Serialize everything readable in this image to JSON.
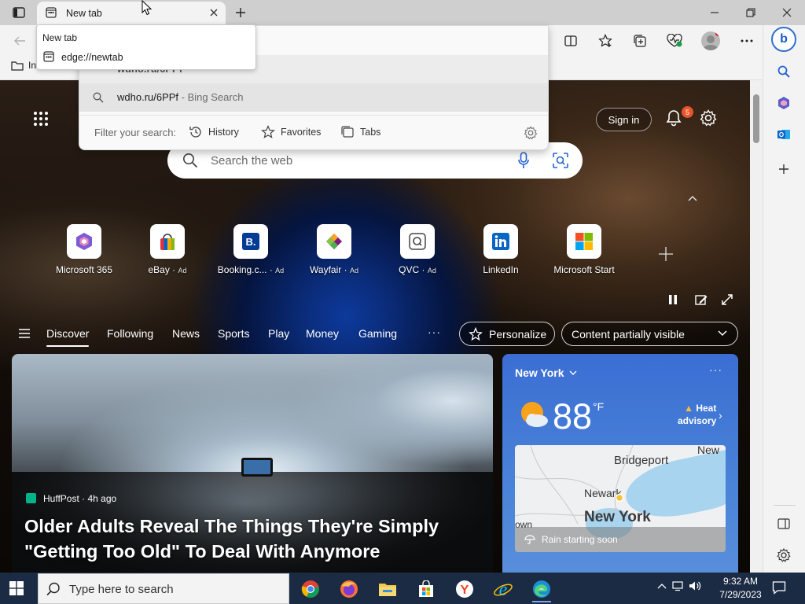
{
  "browser": {
    "tab": {
      "title": "New tab",
      "tooltip_title": "New tab",
      "tooltip_url": "edge://newtab"
    },
    "favorites_bar_item": "In"
  },
  "omnibox": {
    "suggestion_partial": "wdho.ru/6PPf",
    "suggestion_query": "wdho.ru/6PPf",
    "suggestion_engine": " - Bing Search",
    "filter_label": "Filter your search:",
    "filters": [
      "History",
      "Favorites",
      "Tabs"
    ]
  },
  "ntp": {
    "signin_label": "Sign in",
    "notification_count": "5",
    "search_placeholder": "Search the web",
    "tiles": [
      {
        "label": "Microsoft 365",
        "ad": ""
      },
      {
        "label": "eBay",
        "ad": "Ad"
      },
      {
        "label": "Booking.c...",
        "ad": "Ad"
      },
      {
        "label": "Wayfair",
        "ad": "Ad"
      },
      {
        "label": "QVC",
        "ad": "Ad"
      },
      {
        "label": "LinkedIn",
        "ad": ""
      },
      {
        "label": "Microsoft Start",
        "ad": ""
      }
    ],
    "nav": [
      "Discover",
      "Following",
      "News",
      "Sports",
      "Play",
      "Money",
      "Gaming"
    ],
    "nav_more": "···",
    "personalize_label": "Personalize",
    "content_visibility_label": "Content partially visible"
  },
  "news": {
    "source": "HuffPost · 4h ago",
    "headline": "Older Adults Reveal The Things They're Simply \"Getting Too Old\" To Deal With Anymore"
  },
  "weather": {
    "location": "New York",
    "temperature": "88",
    "unit": "°F",
    "alert_line1": "Heat",
    "alert_line2": "advisory",
    "map_labels": [
      "Bridgeport",
      "New",
      "Newark",
      "New York",
      "own"
    ],
    "rain_text": "Rain starting soon"
  },
  "taskbar": {
    "search_placeholder": "Type here to search",
    "time": "9:32 AM",
    "date": "7/29/2023"
  }
}
